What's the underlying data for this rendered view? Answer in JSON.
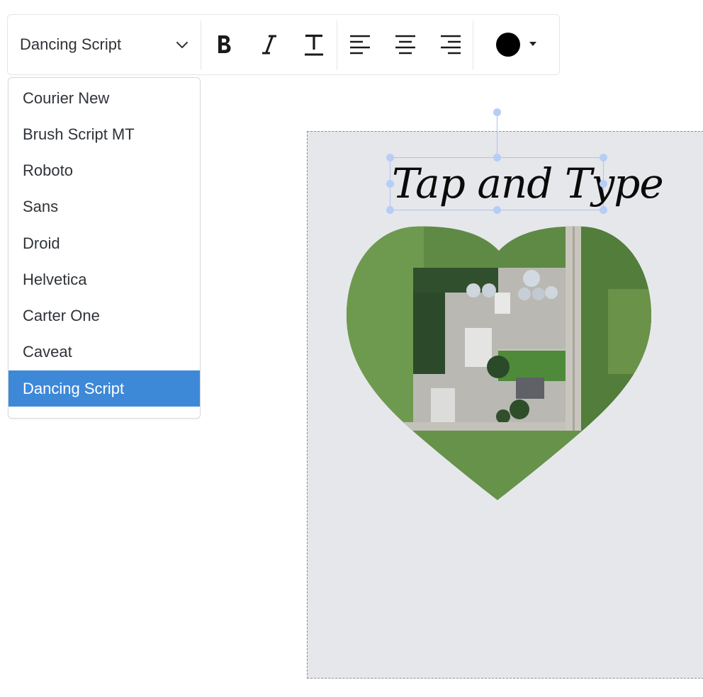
{
  "toolbar": {
    "font_select": {
      "value": "Dancing Script",
      "icon": "chevron-down-icon"
    },
    "format_buttons": [
      {
        "name": "bold-button",
        "icon": "bold-icon"
      },
      {
        "name": "italic-button",
        "icon": "italic-icon"
      },
      {
        "name": "underline-button",
        "icon": "underline-text-icon"
      }
    ],
    "align_buttons": [
      {
        "name": "align-left-button",
        "icon": "align-left-icon"
      },
      {
        "name": "align-center-button",
        "icon": "align-center-icon"
      },
      {
        "name": "align-right-button",
        "icon": "align-right-icon"
      }
    ],
    "color_picker": {
      "color": "#000000",
      "icon": "caret-down-icon"
    }
  },
  "font_dropdown": {
    "options": [
      "Courier New",
      "Brush Script MT",
      "Roboto",
      "Sans",
      "Droid",
      "Helvetica",
      "Carter One",
      "Caveat",
      "Dancing Script"
    ],
    "selected": "Dancing Script",
    "selected_color": "#3e88d8"
  },
  "canvas": {
    "text_element": {
      "text": "Tap and Type"
    },
    "background": "#e6e7eb",
    "image_shape": "heart",
    "image_subject": "aerial view of farmstead"
  }
}
